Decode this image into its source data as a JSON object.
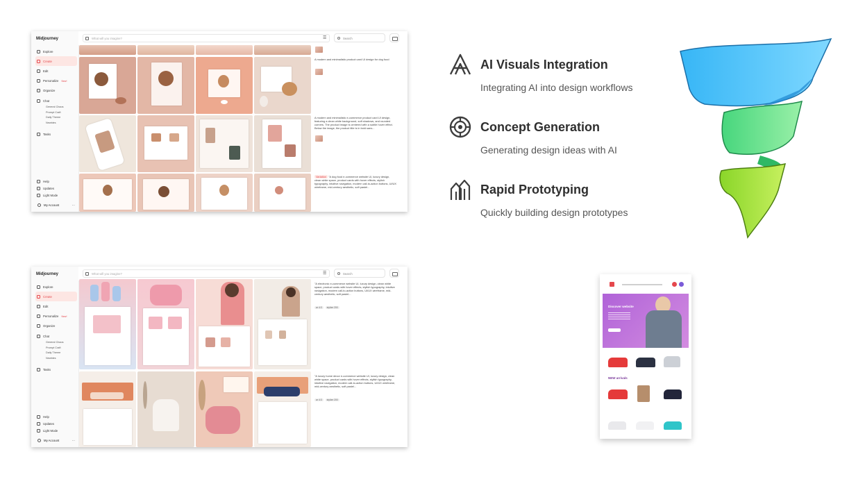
{
  "midjourney_top": {
    "brand": "Midjourney",
    "nav": [
      {
        "label": "Explore",
        "icon": "compass-icon"
      },
      {
        "label": "Create",
        "icon": "brush-icon",
        "active": true
      },
      {
        "label": "Edit",
        "icon": "edit-icon"
      },
      {
        "label": "Personalize",
        "icon": "sparkle-icon",
        "badge": "New!"
      },
      {
        "label": "Organize",
        "icon": "grid-icon"
      },
      {
        "label": "Chat",
        "icon": "chat-icon"
      }
    ],
    "chat_rooms": [
      "General Chaos",
      "Prompt Craft",
      "Daily Theme",
      "Newbies"
    ],
    "tasks": "Tasks",
    "bottom": [
      "Help",
      "Updates",
      "Light Mode"
    ],
    "account": "My Account",
    "account_more": "···",
    "prompt_placeholder": "What will you imagine?",
    "search_placeholder": "Search",
    "chip": "0/0",
    "prompts": [
      "A modern and minimalistic product card UI design for dog food",
      "A modern and minimalistic e-commerce product card UI design, featuring a clean white background, soft shadows, and rounded corners. The product image is centered with a subtle hover effect. Below the image, the product title is in bold sans...",
      "\"A dog food e-commerce website UI, luxury design, clean white space, product cards with hover effects, stylish typography, intuitive navigation, modern call-to-action buttons, UI/UX wireframe, mid-century aesthetic, soft pastel..."
    ],
    "tag": "Variation"
  },
  "midjourney_bottom": {
    "brand": "Midjourney",
    "nav": [
      {
        "label": "Explore",
        "icon": "compass-icon"
      },
      {
        "label": "Create",
        "icon": "brush-icon",
        "active": true
      },
      {
        "label": "Edit",
        "icon": "edit-icon"
      },
      {
        "label": "Personalize",
        "icon": "sparkle-icon",
        "badge": "New!"
      },
      {
        "label": "Organize",
        "icon": "grid-icon"
      },
      {
        "label": "Chat",
        "icon": "chat-icon"
      }
    ],
    "chat_rooms": [
      "General Chaos",
      "Prompt Craft",
      "Daily Theme",
      "Newbies"
    ],
    "tasks": "Tasks",
    "bottom": [
      "Help",
      "Updates",
      "Light Mode"
    ],
    "account": "My Account",
    "account_more": "···",
    "prompt_placeholder": "What will you imagine?",
    "search_placeholder": "Search",
    "chip": "0/0",
    "prompts": [
      "\"A electronic e-commerce website UI, luxury design, clean white space, product cards with hover effects, stylish typography, intuitive navigation, modern call-to-action buttons, UI/UX wireframe, mid-century aesthetic, soft pastel...",
      "\"A luxury home decor e-commerce website UI, luxury design, clean white space, product cards with hover effects, stylish typography, intuitive navigation, modern call-to-action buttons, UI/UX wireframe, mid-century aesthetic, soft pastel..."
    ],
    "badges": [
      "ar 4:3",
      "stylize 200"
    ]
  },
  "features": [
    {
      "title": "AI Visuals Integration",
      "subtitle": "Integrating AI into design workflows",
      "icon": "ai-logo-icon"
    },
    {
      "title": "Concept Generation",
      "subtitle": "Generating design ideas with AI",
      "icon": "target-icon"
    },
    {
      "title": "Rapid Prototyping",
      "subtitle": "Quickly building design prototypes",
      "icon": "arrows-up-icon"
    }
  ],
  "funnel_colors": [
    "#4fc3f7",
    "#5de08a",
    "#a3e635"
  ],
  "accent": "#e5484d",
  "shop_mockup": {
    "hero_line1": "Discover website",
    "section_title": "NEW arrivals"
  }
}
